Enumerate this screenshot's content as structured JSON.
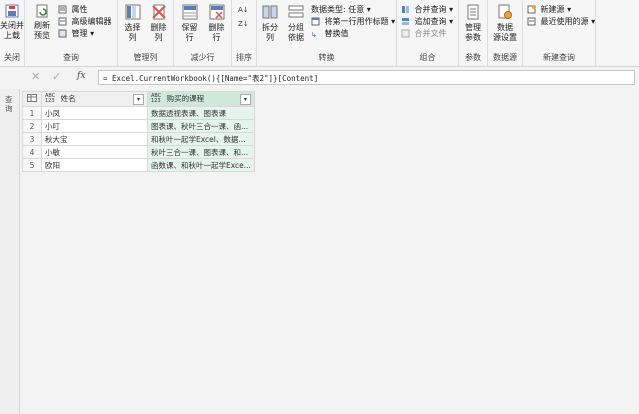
{
  "ribbon": {
    "close": {
      "btn": "关闭并\n上载",
      "label": "关闭"
    },
    "query": {
      "refresh": "刷新\n预览",
      "properties": "属性",
      "advanced_editor": "高级编辑器",
      "manage": "管理",
      "label": "查询"
    },
    "manage_cols": {
      "choose": "选择\n列",
      "remove": "删除\n列",
      "label": "管理列"
    },
    "reduce_rows": {
      "keep": "保留\n行",
      "remove": "删除\n行",
      "label": "减少行"
    },
    "sort": {
      "label": "排序"
    },
    "transform": {
      "split": "拆分\n列",
      "group": "分组\n依据",
      "data_type": "数据类型: 任意",
      "first_row": "将第一行用作标题",
      "replace": "替换值",
      "label": "转换"
    },
    "combine": {
      "merge": "合并查询",
      "append": "追加查询",
      "merge_files": "合并文件",
      "label": "组合"
    },
    "params": {
      "manage": "管理\n参数",
      "label": "参数"
    },
    "datasource": {
      "settings": "数据\n源设置",
      "label": "数据源"
    },
    "newquery": {
      "new_source": "新建源",
      "recent": "最近使用的源",
      "label": "新建查询"
    }
  },
  "formula": {
    "fx": "fx",
    "text": "= Excel.CurrentWorkbook(){[Name=\"表2\"]}[Content]"
  },
  "left_pane": {
    "label": "查询"
  },
  "table": {
    "type_tag": "ABC\n123",
    "columns": [
      "姓名",
      "购买的课程"
    ],
    "rows": [
      {
        "n": "1",
        "name": "小凤",
        "course": "数据透视表课、图表课"
      },
      {
        "n": "2",
        "name": "小叮",
        "course": "图表课、秋叶三合一课、函..."
      },
      {
        "n": "3",
        "name": "秋大宝",
        "course": "和秋叶一起学Excel、数据..."
      },
      {
        "n": "4",
        "name": "小敏",
        "course": "秋叶三合一课、图表课、和..."
      },
      {
        "n": "5",
        "name": "欧阳",
        "course": "函数课、和秋叶一起学Exce..."
      }
    ]
  }
}
